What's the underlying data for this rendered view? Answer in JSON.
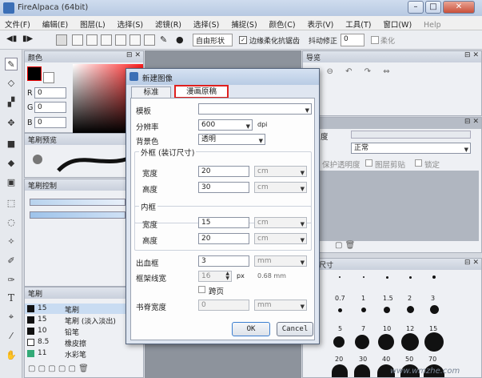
{
  "app": {
    "title": "FireAlpaca (64bit)"
  },
  "menu": [
    "文件(F)",
    "编辑(E)",
    "图层(L)",
    "选择(S)",
    "滤镜(R)",
    "选择(S)",
    "捕捉(S)",
    "颜色(C)",
    "表示(V)",
    "工具(T)",
    "窗口(W)",
    "Help"
  ],
  "toolbar": {
    "mode_value": "自由形状",
    "antialias_label": "边缘柔化抗锯齿",
    "stabilizer_label": "抖动修正",
    "stabilizer_value": "0",
    "snap_label": "柔化"
  },
  "color_panel": {
    "title": "颜色",
    "r_label": "R",
    "g_label": "G",
    "b_label": "B",
    "r": "0",
    "g": "0",
    "b": "0"
  },
  "brush_preview_panel": {
    "title": "笔刷预览"
  },
  "brush_control_panel": {
    "title": "笔刷控制"
  },
  "brush_panel": {
    "title": "笔刷",
    "items": [
      {
        "size": "15",
        "name": "笔刷"
      },
      {
        "size": "15",
        "name": "笔刷 (淡入淡出)"
      },
      {
        "size": "10",
        "name": "铅笔"
      },
      {
        "size": "8.5",
        "name": "橡皮擦"
      },
      {
        "size": "11",
        "name": "水彩笔"
      }
    ]
  },
  "navigator_panel": {
    "title": "导览"
  },
  "layer_panel": {
    "opacity_label": "度",
    "blend_value": "正常",
    "lock_alpha_label": "保护透明度",
    "clip_label": "图层剪贴",
    "lock_label": "锁定",
    "opacity_partial": "明度"
  },
  "brush_size_panel": {
    "title": "尺寸",
    "labels": [
      "0.7",
      "1",
      "1.5",
      "2",
      "3",
      "5",
      "7",
      "10",
      "12",
      "15",
      "20",
      "30",
      "40",
      "50",
      "70"
    ]
  },
  "dialog": {
    "title": "新建图像",
    "tabs": [
      "标准",
      "漫画原稿"
    ],
    "template_label": "模板",
    "resolution_label": "分辨率",
    "resolution_value": "600",
    "resolution_unit": "dpi",
    "bg_label": "背景色",
    "bg_value": "透明",
    "outer_frame_label": "外框 (装订尺寸)",
    "outer_width_label": "宽度",
    "outer_width_value": "20",
    "outer_height_label": "高度",
    "outer_height_value": "30",
    "inner_frame_label": "内框",
    "inner_width_label": "宽度",
    "inner_width_value": "15",
    "inner_height_label": "高度",
    "inner_height_value": "20",
    "unit_cm": "cm",
    "bleed_label": "出血框",
    "bleed_value": "3",
    "bleed_unit": "mm",
    "line_width_label": "框架线宽",
    "line_width_value": "16",
    "line_width_unit": "px",
    "line_width_mm": "0.68 mm",
    "spread_label": "跨页",
    "spine_label": "书脊宽度",
    "spine_value": "0",
    "spine_unit": "mm",
    "ok_label": "OK",
    "cancel_label": "Cancel"
  },
  "watermark": "www.wmzhe.com",
  "colors": {
    "highlight": "#e0201e",
    "dialog_bg": "#dfe6f1",
    "selected_row": "#c9dcf2"
  }
}
